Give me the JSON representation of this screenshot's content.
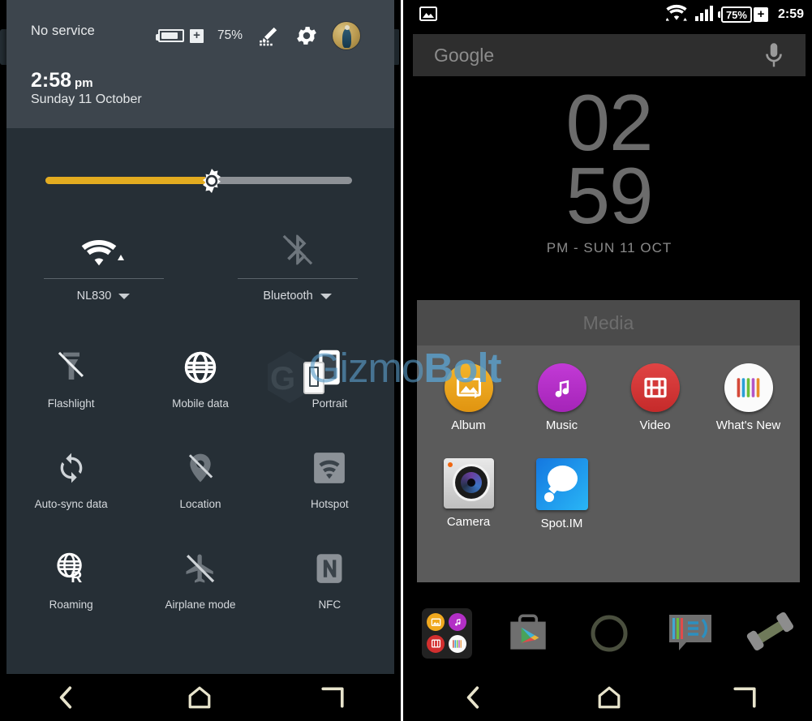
{
  "left_panel": {
    "header": {
      "carrier": "No service",
      "battery_percent": "75%",
      "battery_icon": "battery-stamina-icon",
      "edit_icon": "edit-pencil-icon",
      "settings_icon": "gear-icon",
      "avatar_icon": "user-avatar",
      "clock_time": "2:58",
      "clock_ampm": "pm",
      "date": "Sunday 11 October"
    },
    "brightness": {
      "name": "brightness-slider",
      "value_percent": 52,
      "fill_color": "#e3ac20",
      "track_color": "#8d9196"
    },
    "big_tiles": [
      {
        "label": "NL830",
        "icon": "wifi-icon",
        "enabled": true,
        "has_caret": true
      },
      {
        "label": "Bluetooth",
        "icon": "bluetooth-off-icon",
        "enabled": false,
        "has_caret": true
      }
    ],
    "toggles": [
      {
        "label": "Flashlight",
        "icon": "flashlight-off-icon",
        "enabled": false
      },
      {
        "label": "Mobile data",
        "icon": "globe-icon",
        "enabled": true
      },
      {
        "label": "Portrait",
        "icon": "screen-rotation-portrait-icon",
        "enabled": true
      },
      {
        "label": "Auto-sync data",
        "icon": "sync-icon",
        "enabled": true
      },
      {
        "label": "Location",
        "icon": "location-off-icon",
        "enabled": false
      },
      {
        "label": "Hotspot",
        "icon": "hotspot-icon",
        "enabled": false
      },
      {
        "label": "Roaming",
        "icon": "roaming-icon",
        "enabled": true
      },
      {
        "label": "Airplane mode",
        "icon": "airplane-off-icon",
        "enabled": false
      },
      {
        "label": "NFC",
        "icon": "nfc-icon",
        "enabled": false
      }
    ],
    "navbar": [
      {
        "name": "back-button",
        "icon": "back-chevron-icon"
      },
      {
        "name": "home-button",
        "icon": "home-icon"
      },
      {
        "name": "recents-button",
        "icon": "recents-icon"
      }
    ]
  },
  "right_panel": {
    "statusbar": {
      "left_icon": "screenshot-image-icon",
      "wifi_icon": "wifi-icon",
      "signal_icon": "cellular-signal-icon",
      "battery_percent": "75%",
      "battery_plus": "+",
      "time": "2:59"
    },
    "search": {
      "placeholder": "Google",
      "mic_icon": "microphone-icon"
    },
    "clock_widget": {
      "hours": "02",
      "minutes": "59",
      "sub": "PM - SUN 11 OCT"
    },
    "folder": {
      "title": "Media",
      "rows": [
        [
          {
            "label": "Album",
            "icon": "album-icon",
            "color": "#f0a81e"
          },
          {
            "label": "Music",
            "icon": "music-note-icon",
            "color": "#b32fc6"
          },
          {
            "label": "Video",
            "icon": "film-strip-icon",
            "color": "#d32f2f"
          },
          {
            "label": "What's New",
            "icon": "whats-new-icon",
            "color": "#fafafa"
          }
        ],
        [
          {
            "label": "Camera",
            "icon": "camera-icon",
            "color": "#cccccc"
          },
          {
            "label": "Spot.IM",
            "icon": "spot-im-icon",
            "color": "#2196f3"
          }
        ]
      ]
    },
    "dock": [
      {
        "name": "dock-media-folder",
        "icon": "folder-media-icon"
      },
      {
        "name": "dock-play-store",
        "icon": "play-store-icon"
      },
      {
        "name": "dock-app-drawer",
        "icon": "app-drawer-circle-icon"
      },
      {
        "name": "dock-messaging",
        "icon": "messaging-icon"
      },
      {
        "name": "dock-phone",
        "icon": "phone-handset-icon"
      }
    ],
    "navbar": [
      {
        "name": "back-button",
        "icon": "back-chevron-icon"
      },
      {
        "name": "home-button",
        "icon": "home-icon"
      },
      {
        "name": "recents-button",
        "icon": "recents-icon"
      }
    ]
  },
  "watermark": {
    "part1": "Gizmo",
    "part2": "Bolt",
    "color": "#5b9dc8"
  }
}
